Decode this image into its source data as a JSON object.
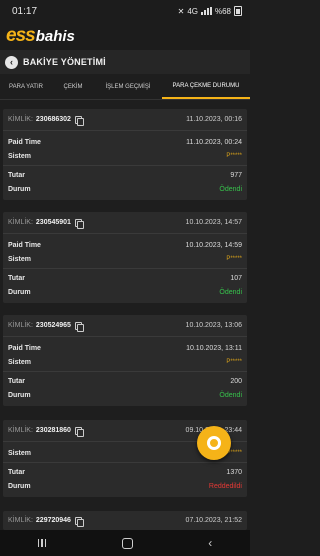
{
  "status_bar": {
    "time": "01:17",
    "network": "4G",
    "battery": "%68"
  },
  "brand": {
    "part1": "ess",
    "part2": "bahis"
  },
  "header": {
    "title": "BAKİYE YÖNETİMİ",
    "back_icon": "back-arrow-icon"
  },
  "tabs": [
    {
      "label": "PARA YATIR",
      "active": false
    },
    {
      "label": "ÇEKİM",
      "active": false
    },
    {
      "label": "İŞLEM GEÇMİŞİ",
      "active": false
    },
    {
      "label": "PARA ÇEKME DURUMU",
      "active": true
    }
  ],
  "labels": {
    "kimlik": "KİMLİK:",
    "paid_time": "Paid Time",
    "sistem": "Sistem",
    "tutar": "Tutar",
    "durum": "Durum"
  },
  "cards": [
    {
      "id": "230686302",
      "date": "11.10.2023, 00:16",
      "paid_time": "11.10.2023, 00:24",
      "sistem": "P*****",
      "tutar": "977",
      "durum": "Ödendi"
    },
    {
      "id": "230545901",
      "date": "10.10.2023, 14:57",
      "paid_time": "10.10.2023, 14:59",
      "sistem": "P*****",
      "tutar": "107",
      "durum": "Ödendi"
    },
    {
      "id": "230524965",
      "date": "10.10.2023, 13:06",
      "paid_time": "10.10.2023, 13:11",
      "sistem": "P*****",
      "tutar": "200",
      "durum": "Ödendi"
    },
    {
      "id": "230281860",
      "date": "09.10.2023, 23:44",
      "paid_time": "",
      "sistem": "P*****",
      "tutar": "1370",
      "durum": "Reddedildi"
    },
    {
      "id": "229720946",
      "date": "07.10.2023, 21:52"
    }
  ],
  "colors": {
    "accent": "#f5b318",
    "success": "#37c24c",
    "danger": "#e53935"
  }
}
